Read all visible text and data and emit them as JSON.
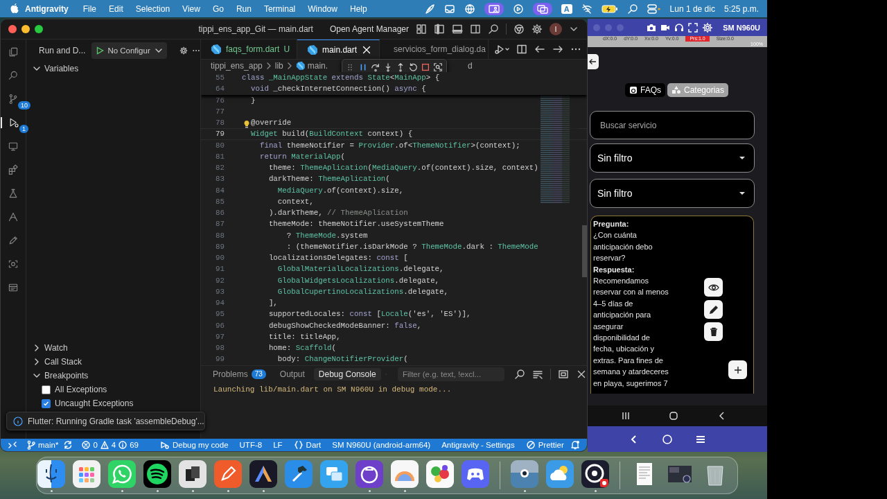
{
  "menu_bar": {
    "app_name": "Antigravity",
    "menus": [
      "File",
      "Edit",
      "Selection",
      "View",
      "Go",
      "Run",
      "Terminal",
      "Window",
      "Help"
    ],
    "input_source": "A",
    "date": "Lun 1 de dic",
    "time": "5:25 p.m."
  },
  "editor_window": {
    "title": "tippi_ens_app_Git — main.dart",
    "agent_manager": "Open Agent Manager",
    "avatar": "I",
    "activity_bar": [
      {
        "kind": "files",
        "selected": false
      },
      {
        "kind": "search",
        "selected": false
      },
      {
        "kind": "source-control",
        "selected": false,
        "badge": "10"
      },
      {
        "kind": "run-debug",
        "selected": true,
        "badge": "1"
      },
      {
        "kind": "remote",
        "selected": false
      },
      {
        "kind": "extensions",
        "selected": false
      },
      {
        "kind": "testing",
        "selected": false
      },
      {
        "kind": "agent",
        "selected": false
      },
      {
        "kind": "pen",
        "selected": false
      },
      {
        "kind": "scan",
        "selected": false
      },
      {
        "kind": "panel",
        "selected": false
      }
    ],
    "run_panel": {
      "title": "Run and D...",
      "configuration": "No Configur",
      "sections": [
        {
          "label": "Variables",
          "expanded": true
        },
        {
          "label": "Watch",
          "expanded": false
        },
        {
          "label": "Call Stack",
          "expanded": false
        },
        {
          "label": "Breakpoints",
          "expanded": true,
          "items": [
            {
              "label": "All Exceptions",
              "checked": false
            },
            {
              "label": "Uncaught Exceptions",
              "checked": true
            }
          ]
        }
      ]
    },
    "tabs": [
      {
        "label": "faqs_form.dart",
        "status": "U",
        "selected": false
      },
      {
        "label": "main.dart",
        "selected": true
      },
      {
        "label": "servicios_form_dialog.da",
        "selected": false
      }
    ],
    "breadcrumb": [
      "tippi_ens_app",
      "lib",
      "main."
    ],
    "breadcrumb_tail": "d",
    "code": {
      "sticky_lines": [
        {
          "number": "55",
          "tokens": [
            {
              "text": "class ",
              "kind": "keyword"
            },
            {
              "text": "_MainAppState ",
              "kind": "type"
            },
            {
              "text": "extends ",
              "kind": "keyword"
            },
            {
              "text": "State",
              "kind": "type"
            },
            {
              "text": "<",
              "kind": "plain"
            },
            {
              "text": "MainApp",
              "kind": "type"
            },
            {
              "text": "> {",
              "kind": "plain"
            }
          ]
        },
        {
          "number": "64",
          "tokens": [
            {
              "text": "  void ",
              "kind": "keyword"
            },
            {
              "text": "_checkInternetConnection() ",
              "kind": "plain"
            },
            {
              "text": "async ",
              "kind": "keyword"
            },
            {
              "text": "{",
              "kind": "plain"
            }
          ]
        }
      ],
      "lines": [
        {
          "number": "76",
          "current": false,
          "kind": "plain",
          "tokens": [
            {
              "text": "  }",
              "kind": "plain"
            }
          ]
        },
        {
          "number": "77",
          "current": false,
          "kind": "plain"
        },
        {
          "number": "78",
          "current": false,
          "kind": "lightbulb",
          "tokens": [
            {
              "text": "  @override",
              "kind": "plain"
            }
          ]
        },
        {
          "number": "79",
          "current": true,
          "kind": "plain",
          "tokens": [
            {
              "text": "  Widget ",
              "kind": "type"
            },
            {
              "text": "build(",
              "kind": "plain"
            },
            {
              "text": "BuildContext ",
              "kind": "type"
            },
            {
              "text": "context) {",
              "kind": "plain"
            }
          ]
        },
        {
          "number": "80",
          "current": false,
          "kind": "plain",
          "tokens": [
            {
              "text": "    final ",
              "kind": "keyword"
            },
            {
              "text": "themeNotifier = ",
              "kind": "plain"
            },
            {
              "text": "Provider",
              "kind": "type"
            },
            {
              "text": ".of<",
              "kind": "plain"
            },
            {
              "text": "ThemeNotifier",
              "kind": "type"
            },
            {
              "text": ">(context);",
              "kind": "plain"
            }
          ]
        },
        {
          "number": "81",
          "current": false,
          "kind": "plain",
          "tokens": [
            {
              "text": "    return ",
              "kind": "keyword"
            },
            {
              "text": "MaterialApp",
              "kind": "type"
            },
            {
              "text": "(",
              "kind": "plain"
            }
          ]
        },
        {
          "number": "82",
          "current": false,
          "kind": "plain",
          "tokens": [
            {
              "text": "      theme: ",
              "kind": "plain"
            },
            {
              "text": "ThemeAplication",
              "kind": "type"
            },
            {
              "text": "(",
              "kind": "plain"
            },
            {
              "text": "MediaQuery",
              "kind": "type"
            },
            {
              "text": ".of(context).size, context)",
              "kind": "plain"
            }
          ]
        },
        {
          "number": "83",
          "current": false,
          "kind": "plain",
          "tokens": [
            {
              "text": "      darkTheme: ",
              "kind": "plain"
            },
            {
              "text": "ThemeAplication",
              "kind": "type"
            },
            {
              "text": "(",
              "kind": "plain"
            }
          ]
        },
        {
          "number": "84",
          "current": false,
          "kind": "plain",
          "tokens": [
            {
              "text": "        MediaQuery",
              "kind": "type"
            },
            {
              "text": ".of(context).size,",
              "kind": "plain"
            }
          ]
        },
        {
          "number": "85",
          "current": false,
          "kind": "plain",
          "tokens": [
            {
              "text": "        context,",
              "kind": "plain"
            }
          ]
        },
        {
          "number": "86",
          "current": false,
          "kind": "plain",
          "tokens": [
            {
              "text": "      ).darkTheme, ",
              "kind": "plain"
            },
            {
              "text": "// ThemeAplication",
              "kind": "comment"
            }
          ]
        },
        {
          "number": "87",
          "current": false,
          "kind": "plain",
          "tokens": [
            {
              "text": "      themeMode: themeNotifier.useSystemTheme",
              "kind": "plain"
            }
          ]
        },
        {
          "number": "88",
          "current": false,
          "kind": "plain",
          "tokens": [
            {
              "text": "          ? ",
              "kind": "plain"
            },
            {
              "text": "ThemeMode",
              "kind": "type"
            },
            {
              "text": ".system",
              "kind": "plain"
            }
          ]
        },
        {
          "number": "89",
          "current": false,
          "kind": "plain",
          "tokens": [
            {
              "text": "          : (themeNotifier.isDarkMode ? ",
              "kind": "plain"
            },
            {
              "text": "ThemeMode",
              "kind": "type"
            },
            {
              "text": ".dark : ",
              "kind": "plain"
            },
            {
              "text": "ThemeMode",
              "kind": "type"
            }
          ]
        },
        {
          "number": "90",
          "current": false,
          "kind": "plain",
          "tokens": [
            {
              "text": "      localizationsDelegates: ",
              "kind": "plain"
            },
            {
              "text": "const ",
              "kind": "keyword"
            },
            {
              "text": "[",
              "kind": "plain"
            }
          ]
        },
        {
          "number": "91",
          "current": false,
          "kind": "plain",
          "tokens": [
            {
              "text": "        GlobalMaterialLocalizations",
              "kind": "type"
            },
            {
              "text": ".delegate,",
              "kind": "plain"
            }
          ]
        },
        {
          "number": "92",
          "current": false,
          "kind": "plain",
          "tokens": [
            {
              "text": "        GlobalWidgetsLocalizations",
              "kind": "type"
            },
            {
              "text": ".delegate,",
              "kind": "plain"
            }
          ]
        },
        {
          "number": "93",
          "current": false,
          "kind": "plain",
          "tokens": [
            {
              "text": "        GlobalCupertinoLocalizations",
              "kind": "type"
            },
            {
              "text": ".delegate,",
              "kind": "plain"
            }
          ]
        },
        {
          "number": "94",
          "current": false,
          "kind": "plain",
          "tokens": [
            {
              "text": "      ],",
              "kind": "plain"
            }
          ]
        },
        {
          "number": "95",
          "current": false,
          "kind": "plain",
          "tokens": [
            {
              "text": "      supportedLocales: ",
              "kind": "plain"
            },
            {
              "text": "const ",
              "kind": "keyword"
            },
            {
              "text": "[",
              "kind": "plain"
            },
            {
              "text": "Locale",
              "kind": "type"
            },
            {
              "text": "('es', 'ES')],",
              "kind": "plain"
            }
          ]
        },
        {
          "number": "96",
          "current": false,
          "kind": "plain",
          "tokens": [
            {
              "text": "      debugShowCheckedModeBanner: ",
              "kind": "plain"
            },
            {
              "text": "false",
              "kind": "keyword"
            },
            {
              "text": ",",
              "kind": "plain"
            }
          ]
        },
        {
          "number": "97",
          "current": false,
          "kind": "plain",
          "tokens": [
            {
              "text": "      title: titleApp,",
              "kind": "plain"
            }
          ]
        },
        {
          "number": "98",
          "current": false,
          "kind": "plain",
          "tokens": [
            {
              "text": "      home: ",
              "kind": "plain"
            },
            {
              "text": "Scaffold",
              "kind": "type"
            },
            {
              "text": "(",
              "kind": "plain"
            }
          ]
        },
        {
          "number": "99",
          "current": false,
          "kind": "plain",
          "tokens": [
            {
              "text": "        body: ",
              "kind": "plain"
            },
            {
              "text": "ChangeNotifierProvider",
              "kind": "type"
            },
            {
              "text": "(",
              "kind": "plain"
            }
          ]
        }
      ]
    },
    "panel": {
      "tabs": [
        {
          "label": "Problems",
          "badge": "73",
          "selected": false
        },
        {
          "label": "Output",
          "selected": false
        },
        {
          "label": "Debug Console",
          "selected": true
        }
      ],
      "filter": {
        "placeholder": "Filter (e.g. text, !excl..."
      },
      "output": [
        "Launching lib/main.dart on SM N960U in debug mode..."
      ]
    },
    "notification": "Flutter: Running Gradle task 'assembleDebug'...",
    "status_bar": {
      "branch": "main*",
      "errors": "0",
      "warnings": "4",
      "infos": "69",
      "items": [
        {
          "label": "Debug my code",
          "kind": "debug"
        },
        {
          "label": "UTF-8",
          "kind": "text"
        },
        {
          "label": "LF",
          "kind": "text"
        },
        {
          "label": "Dart",
          "kind": "language"
        },
        {
          "label": "SM N960U (android-arm64)",
          "kind": "text"
        },
        {
          "label": "Antigravity - Settings",
          "kind": "text"
        },
        {
          "label": "Prettier",
          "kind": "formatter"
        }
      ]
    }
  },
  "emulator": {
    "title": "SM N960U",
    "phone_status": {
      "pointer_info": [
        "dX:0.0",
        "dY:0.0",
        "Xv:0.0",
        "Yv:0.0",
        "Prs:1.0",
        "Size:0.0"
      ],
      "battery": "100%"
    },
    "app": {
      "tabs": [
        {
          "label": "FAQs",
          "selected": true
        },
        {
          "label": "Categorias",
          "selected": false
        }
      ],
      "search": {
        "placeholder": "Buscar servicio"
      },
      "filters": [
        "Sin filtro",
        "Sin filtro"
      ],
      "card": {
        "question_label": "Pregunta:",
        "question": "¿Con cuánta anticipación debo reservar?",
        "answer_label": "Respuesta:",
        "answer": "Recomendamos reservar con al menos 4–5 días de anticipación para asegurar disponibilidad de fecha, ubicación y extras. Para fines de semana y atardeceres en playa, sugerimos 7"
      }
    }
  },
  "dock": {
    "groups": [
      {
        "items": [
          {
            "kind": "face",
            "running": true
          },
          {
            "kind": "grid",
            "running": false
          },
          {
            "kind": "chat",
            "running": true
          },
          {
            "kind": "waves",
            "running": true
          },
          {
            "kind": "squares",
            "running": true
          },
          {
            "kind": "pen",
            "running": true
          },
          {
            "kind": "peak",
            "running": true
          },
          {
            "kind": "hammer",
            "running": false
          },
          {
            "kind": "windows",
            "running": false
          },
          {
            "kind": "cat",
            "running": true
          },
          {
            "kind": "sunrise",
            "running": true
          },
          {
            "kind": "game",
            "running": false
          },
          {
            "kind": "controller",
            "running": false
          }
        ]
      },
      {
        "items": [
          {
            "kind": "eye",
            "running": true
          },
          {
            "kind": "cloud",
            "running": false
          },
          {
            "kind": "ring",
            "running": true
          }
        ]
      },
      {
        "items": [
          {
            "kind": "document",
            "running": false
          },
          {
            "kind": "screenshot",
            "running": false
          },
          {
            "kind": "trash",
            "running": false
          }
        ]
      }
    ]
  }
}
